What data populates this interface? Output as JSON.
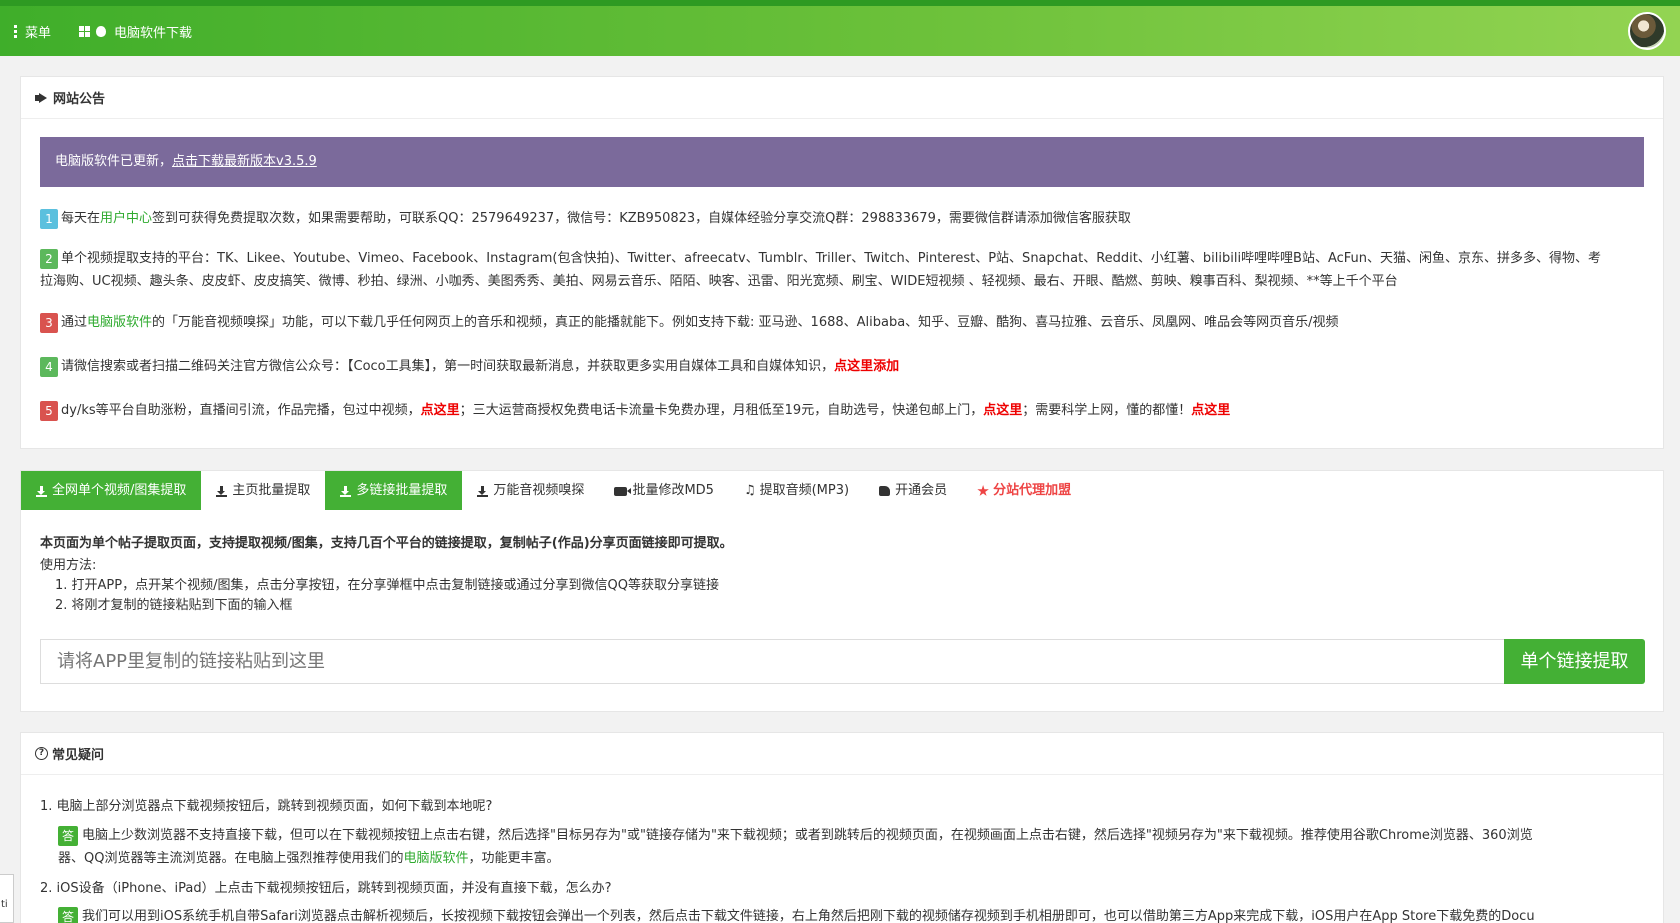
{
  "topbar": {
    "menu_label": "菜单",
    "pc_label": "电脑软件下载"
  },
  "announce": {
    "title": "网站公告",
    "notice_text": "电脑版软件已更新，",
    "notice_link": "点击下载最新版本v3.5.9",
    "item1": {
      "num": "1",
      "pre": "每天在",
      "link": "用户中心",
      "post": "签到可获得免费提取次数，如果需要帮助，可联系QQ：2579649237，微信号：KZB950823，自媒体经验分享交流Q群：298833679，需要微信群请添加微信客服获取"
    },
    "item2": {
      "num": "2",
      "line1": "单个视频提取支持的平台：TK、Likee、Youtube、Vimeo、Facebook、Instagram(包含快拍)、Twitter、afreecatv、Tumblr、Triller、Twitch、Pinterest、P站、Snapchat、Reddit、小红薯、bilibili哔哩哔哩B站、AcFun、天猫、闲鱼、京东、拼多多、得物、考",
      "line2": "拉海购、UC视频、趣头条、皮皮虾、皮皮搞笑、微博、秒拍、绿洲、小咖秀、美图秀秀、美拍、网易云音乐、陌陌、映客、迅雷、阳光宽频、刷宝、WIDE短视频 、轻视频、最右、开眼、酷燃、剪映、糗事百科、梨视频、**等上千个平台"
    },
    "item3": {
      "num": "3",
      "pre": "通过",
      "link": "电脑版软件",
      "post": "的「万能音视频嗅探」功能，可以下载几乎任何网页上的音乐和视频，真正的能播就能下。例如支持下载: 亚马逊、1688、Alibaba、知乎、豆瓣、酷狗、喜马拉雅、云音乐、凤凰网、唯品会等网页音乐/视频"
    },
    "item4": {
      "num": "4",
      "pre": "请微信搜索或者扫描二维码关注官方微信公众号：【Coco工具集】，第一时间获取最新消息，并获取更多实用自媒体工具和自媒体知识，",
      "link": "点这里添加"
    },
    "item5": {
      "num": "5",
      "t1": "dy/ks等平台自助涨粉，直播间引流，作品完播，包过中视频，",
      "l1": "点这里",
      "t2": "；三大运营商授权免费电话卡流量卡免费办理，月租低至19元，自助选号，快递包邮上门，",
      "l2": "点这里",
      "t3": "；需要科学上网，懂的都懂！",
      "l3": "点这里"
    }
  },
  "tabs": [
    "全网单个视频/图集提取",
    "主页批量提取",
    "多链接批量提取",
    "万能音视频嗅探",
    "批量修改MD5",
    "提取音频(MP3)",
    "开通会员",
    "分站代理加盟"
  ],
  "extract": {
    "intro": "本页面为单个帖子提取页面，支持提取视频/图集，支持几百个平台的链接提取，复制帖子(作品)分享页面链接即可提取。",
    "usage_title": "使用方法:",
    "step1": "1. 打开APP，点开某个视频/图集，点击分享按钮，在分享弹框中点击复制链接或通过分享到微信QQ等获取分享链接",
    "step2": "2. 将刚才复制的链接粘贴到下面的输入框",
    "input_placeholder": "请将APP里复制的链接粘贴到这里",
    "button_label": "单个链接提取"
  },
  "faq": {
    "title": "常见疑问",
    "q1": "1. 电脑上部分浏览器点下载视频按钮后，跳转到视频页面，如何下载到本地呢?",
    "ans_label": "答",
    "a1_line1": "电脑上少数浏览器不支持直接下载，但可以在下载视频按钮上点击右键，然后选择\"目标另存为\"或\"链接存储为\"来下载视频；或者到跳转后的视频页面，在视频画面上点击右键，然后选择\"视频另存为\"来下载视频。推荐使用谷歌Chrome浏览器、360浏览",
    "a1_line2_pre": "器、QQ浏览器等主流浏览器。在电脑上强烈推荐使用我们的",
    "a1_link": "电脑版软件",
    "a1_line2_post": "，功能更丰富。",
    "q2": "2. iOS设备（iPhone、iPad）上点击下载视频按钮后，跳转到视频页面，并没有直接下载，怎么办?",
    "a2_line1": "我们可以用到iOS系统手机自带Safari浏览器点击解析视频后，长按视频下载按钮会弹出一个列表，然后点击下载文件链接，右上角然后把刚下载的视频储存视频到手机相册即可，也可以借助第三方App来完成下载，iOS用户在App Store下载免费的Docu"
  },
  "corner_text": "ti"
}
